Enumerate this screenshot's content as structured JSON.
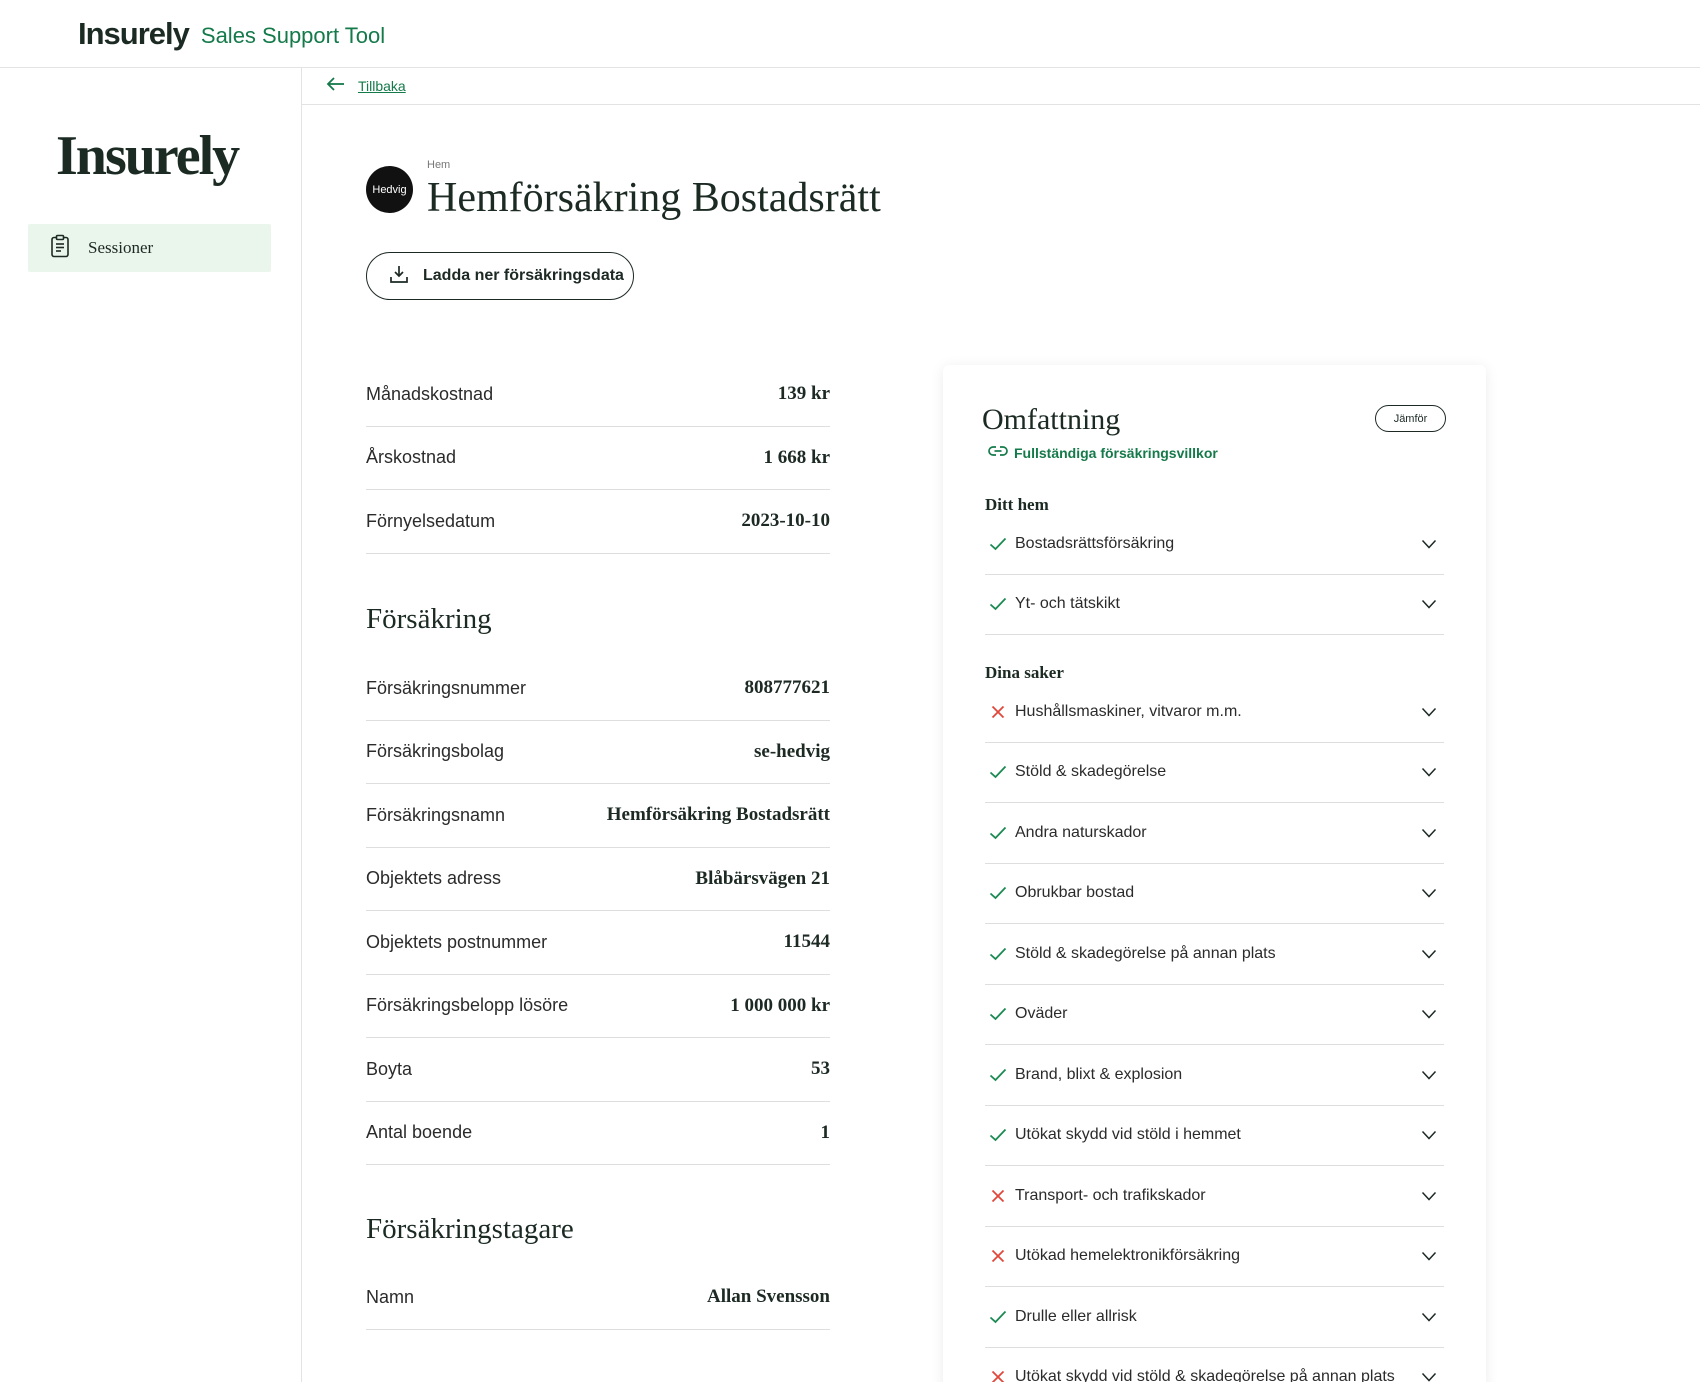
{
  "topbar": {
    "brand": "Insurely",
    "tool_name": "Sales Support Tool"
  },
  "sidebar": {
    "logo": "Insurely",
    "items": [
      {
        "label": "Sessioner",
        "icon": "clipboard-icon",
        "active": true
      }
    ]
  },
  "back": {
    "label": "Tillbaka"
  },
  "header": {
    "insurer_logo_text": "Hedvig",
    "breadcrumb": "Hem",
    "title": "Hemförsäkring Bostadsrätt",
    "download_label": "Ladda ner försäkringsdata"
  },
  "costs": [
    {
      "label": "Månadskostnad",
      "value": "139 kr"
    },
    {
      "label": "Årskostnad",
      "value": "1 668 kr"
    },
    {
      "label": "Förnyelsedatum",
      "value": "2023-10-10"
    }
  ],
  "insurance": {
    "title": "Försäkring",
    "rows": [
      {
        "label": "Försäkringsnummer",
        "value": "808777621"
      },
      {
        "label": "Försäkringsbolag",
        "value": "se-hedvig"
      },
      {
        "label": "Försäkringsnamn",
        "value": "Hemförsäkring Bostadsrätt"
      },
      {
        "label": "Objektets adress",
        "value": "Blåbärsvägen 21"
      },
      {
        "label": "Objektets postnummer",
        "value": "11544"
      },
      {
        "label": "Försäkringsbelopp lösöre",
        "value": "1 000 000 kr"
      },
      {
        "label": "Boyta",
        "value": "53"
      },
      {
        "label": "Antal boende",
        "value": "1"
      }
    ]
  },
  "holder": {
    "title": "Försäkringstagare",
    "rows": [
      {
        "label": "Namn",
        "value": "Allan Svensson"
      }
    ]
  },
  "coverage": {
    "title": "Omfattning",
    "compare_label": "Jämför",
    "terms_link": "Fullständiga försäkringsvillkor",
    "colors": {
      "included": "#1a8a52",
      "excluded": "#e0463a"
    },
    "groups": [
      {
        "title": "Ditt hem",
        "items": [
          {
            "name": "Bostadsrättsförsäkring",
            "included": true
          },
          {
            "name": "Yt- och tätskikt",
            "included": true
          }
        ]
      },
      {
        "title": "Dina saker",
        "items": [
          {
            "name": "Hushållsmaskiner, vitvaror m.m.",
            "included": false
          },
          {
            "name": "Stöld & skadegörelse",
            "included": true
          },
          {
            "name": "Andra naturskador",
            "included": true
          },
          {
            "name": "Obrukbar bostad",
            "included": true
          },
          {
            "name": "Stöld & skadegörelse på annan plats",
            "included": true
          },
          {
            "name": "Oväder",
            "included": true
          },
          {
            "name": "Brand, blixt & explosion",
            "included": true
          },
          {
            "name": "Utökat skydd vid stöld i hemmet",
            "included": true
          },
          {
            "name": "Transport- och trafikskador",
            "included": false
          },
          {
            "name": "Utökad hemelektronikförsäkring",
            "included": false
          },
          {
            "name": "Drulle eller allrisk",
            "included": true
          },
          {
            "name": "Utökat skydd vid stöld & skadegörelse på annan plats",
            "included": false
          }
        ]
      }
    ]
  }
}
